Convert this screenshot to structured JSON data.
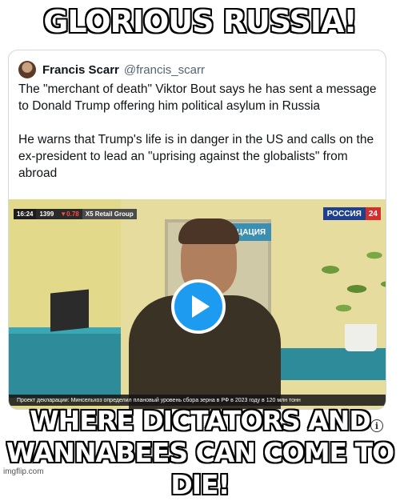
{
  "meme": {
    "top_text": "GLORIOUS RUSSIA!",
    "bottom_text_line1": "WHERE DICTATORS AND",
    "bottom_text_line2": "WANNABEES CAN COME TO DIE!",
    "watermark": "imgflip.com"
  },
  "tweet": {
    "author_name": "Francis Scarr",
    "author_handle": "@francis_scarr",
    "paragraph1": "The \"merchant of death\" Viktor Bout says he has sent a message to Donald Trump offering him political asylum in Russia",
    "paragraph2": "He warns that Trump's life is in danger in the US and calls on the ex-president to lead an \"uprising against the globalists\" from abroad"
  },
  "video": {
    "time": "16:24",
    "index_value": "1399",
    "index_change": "▼0.78",
    "ticker_name": "X5 Retail Group",
    "channel_name": "РОССИЯ",
    "channel_number": "24",
    "wall_sign": "ЦАЦИЯ",
    "bottom_ticker": "Проект декларации: Минсельхоз определил плановый уровень сбора зерна в РФ в 2023 году в 120 млн тонн"
  },
  "icons": {
    "play": "play-icon",
    "info": "info-icon"
  },
  "colors": {
    "play_button": "#1d9bf0",
    "channel_blue": "#1f3f8f",
    "channel_red": "#d32f2f"
  }
}
